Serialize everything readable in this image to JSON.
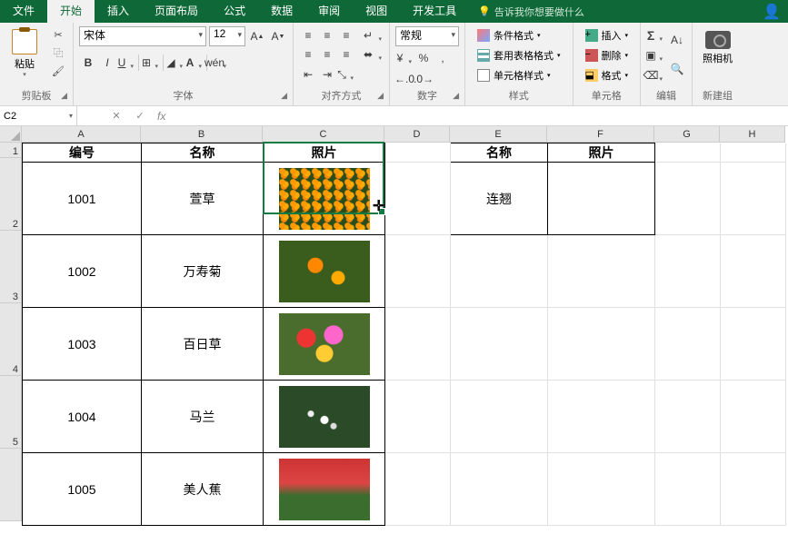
{
  "tabs": [
    "文件",
    "开始",
    "插入",
    "页面布局",
    "公式",
    "数据",
    "审阅",
    "视图",
    "开发工具"
  ],
  "activeTab": 1,
  "tellme": "告诉我你想要做什么",
  "ribbon": {
    "clipboard": {
      "paste": "粘贴",
      "label": "剪贴板"
    },
    "font": {
      "name": "宋体",
      "size": "12",
      "buttons": {
        "b": "B",
        "i": "I",
        "u": "U",
        "wen": "wén"
      },
      "label": "字体"
    },
    "align": {
      "label": "对齐方式"
    },
    "number": {
      "format": "常规",
      "label": "数字"
    },
    "styles": {
      "cond": "条件格式",
      "tblfmt": "套用表格格式",
      "cellfmt": "单元格样式",
      "label": "样式"
    },
    "cells": {
      "insert": "插入",
      "delete": "删除",
      "format": "格式",
      "label": "单元格"
    },
    "editing": {
      "label": "编辑"
    },
    "camera": {
      "btn": "照相机",
      "label": "新建组"
    }
  },
  "nameBox": "C2",
  "formula": "",
  "cols": [
    "A",
    "B",
    "C",
    "D",
    "E",
    "F",
    "G",
    "H"
  ],
  "rows": [
    "1",
    "2",
    "3",
    "4",
    "5"
  ],
  "head": {
    "id": "编号",
    "name": "名称",
    "photo": "照片"
  },
  "data": [
    {
      "id": "1001",
      "name": "萱草"
    },
    {
      "id": "1002",
      "name": "万寿菊"
    },
    {
      "id": "1003",
      "name": "百日草"
    },
    {
      "id": "1004",
      "name": "马兰"
    },
    {
      "id": "1005",
      "name": "美人蕉"
    }
  ],
  "lookupName": "连翘",
  "selectedCell": "C2"
}
